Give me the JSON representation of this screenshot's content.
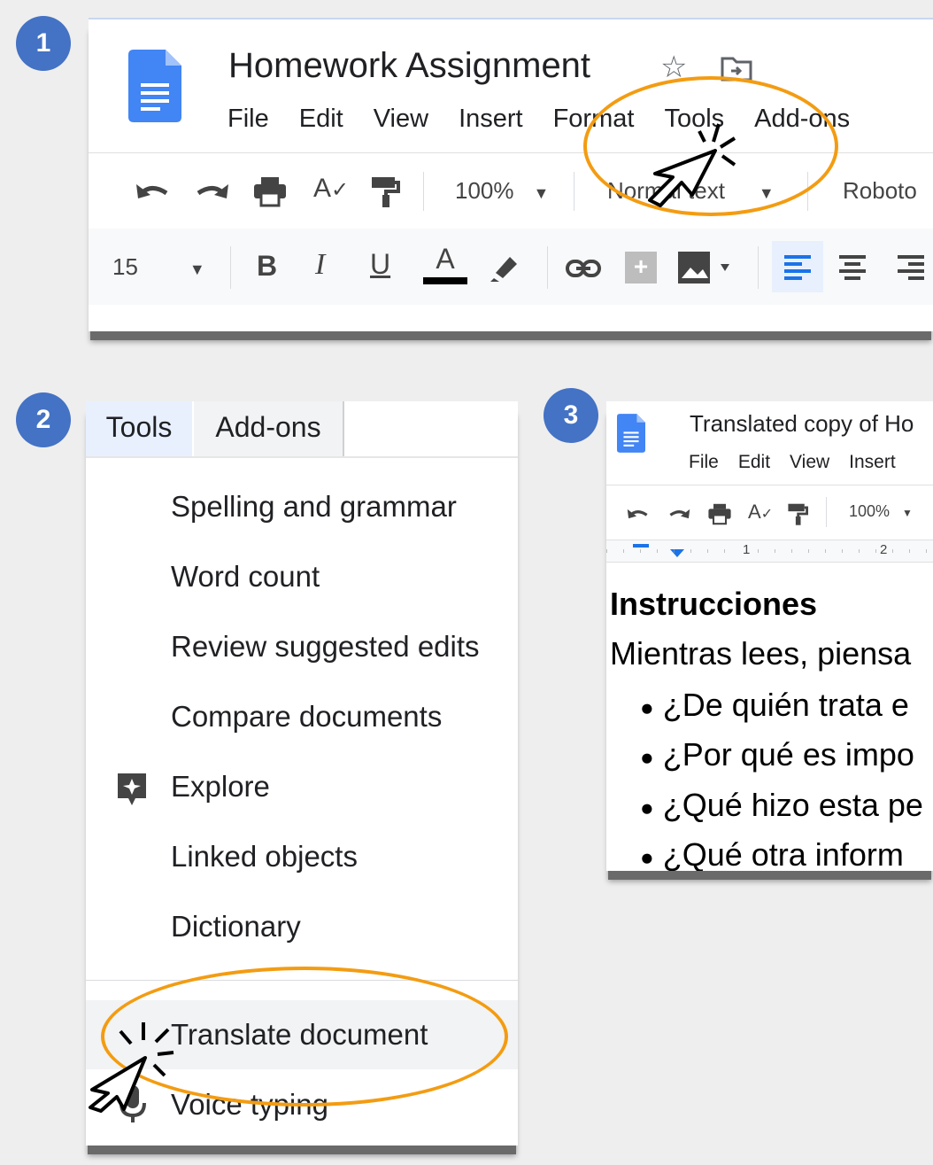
{
  "steps": [
    "1",
    "2",
    "3"
  ],
  "doc1": {
    "title": "Homework Assignment",
    "menu": [
      "File",
      "Edit",
      "View",
      "Insert",
      "Format",
      "Tools",
      "Add-ons"
    ],
    "zoom": "100%",
    "style": "Normal text",
    "font": "Roboto",
    "font_size": "15"
  },
  "tools_menu": {
    "headers": [
      "Tools",
      "Add-ons"
    ],
    "items": [
      "Spelling and grammar",
      "Word count",
      "Review suggested edits",
      "Compare documents",
      "Explore",
      "Linked objects",
      "Dictionary",
      "Translate document",
      "Voice typing"
    ]
  },
  "doc3": {
    "title": "Translated copy of Ho",
    "menu": [
      "File",
      "Edit",
      "View",
      "Insert"
    ],
    "zoom": "100%",
    "ruler": [
      "1",
      "2"
    ],
    "heading": "Instrucciones",
    "intro": "Mientras lees, piensa",
    "bullets": [
      "¿De quién trata e",
      "¿Por qué es impo",
      "¿Qué hizo esta pe",
      "¿Qué otra inform"
    ]
  },
  "colors": {
    "accent": "#4472c4",
    "highlight": "#f39c12",
    "docs_blue": "#4285f4"
  }
}
